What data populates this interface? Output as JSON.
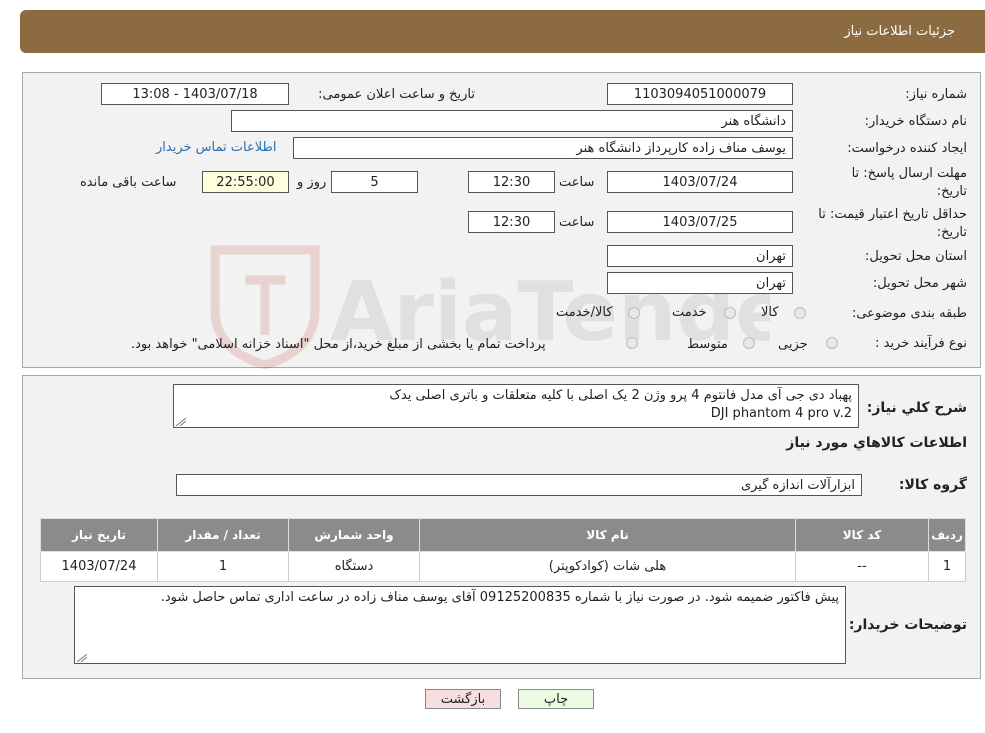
{
  "header": {
    "title": "جزئیات اطلاعات نیاز"
  },
  "fields": {
    "need_number_label": "شماره نیاز:",
    "need_number": "1103094051000079",
    "announce_label": "تاریخ و ساعت اعلان عمومی:",
    "announce_value": "1403/07/18 - 13:08",
    "buyer_org_label": "نام دستگاه خریدار:",
    "buyer_org": "دانشگاه هنر",
    "creator_label": "ایجاد کننده درخواست:",
    "creator": "یوسف مناف زاده کارپرداز دانشگاه هنر",
    "contact_link": "اطلاعات تماس خریدار",
    "deadline_label_1": "مهلت ارسال پاسخ: تا",
    "deadline_label_2": "تاریخ:",
    "deadline_date": "1403/07/24",
    "time_label": "ساعت",
    "deadline_time": "12:30",
    "days_value": "5",
    "days_label": "روز و",
    "remaining_time": "22:55:00",
    "remaining_label": "ساعت باقی مانده",
    "validity_label_1": "حداقل تاریخ اعتبار قیمت: تا",
    "validity_label_2": "تاریخ:",
    "validity_date": "1403/07/25",
    "validity_time": "12:30",
    "province_label": "استان محل تحویل:",
    "province": "تهران",
    "city_label": "شهر محل تحویل:",
    "city": "تهران",
    "category_label": "طبقه بندی موضوعی:",
    "category_options": [
      "کالا",
      "خدمت",
      "کالا/خدمت"
    ],
    "process_label": "نوع فرآیند خرید :",
    "process_options": [
      "جزیی",
      "متوسط"
    ],
    "process_note": "پرداخت تمام یا بخشی از مبلغ خرید،از محل \"اسناد خزانه اسلامی\" خواهد بود."
  },
  "details": {
    "summary_label": "شرح کلي نياز:",
    "summary_line1": "پهباد دی جی آی مدل فانتوم 4 پرو وژن 2  یک اصلی با کلیه متعلقات و باتری  اصلی یدک",
    "summary_line2": "DJI phantom 4 pro v.2",
    "goods_info_title": "اطلاعات کالاهاي مورد نياز",
    "group_label": "گروه کالا:",
    "group_value": "ابزارآلات اندازه گیری",
    "table": {
      "headers": [
        "ردیف",
        "کد کالا",
        "نام کالا",
        "واحد شمارش",
        "تعداد / مقدار",
        "تاریخ نیاز"
      ],
      "rows": [
        [
          "1",
          "--",
          "هلی شات (کوادکوپتر)",
          "دستگاه",
          "1",
          "1403/07/24"
        ]
      ]
    },
    "buyer_notes_label": "توضیحات خریدار:",
    "buyer_notes": "پیش فاکتور ضمیمه شود. در صورت نیاز با شماره 09125200835 آقای یوسف مناف زاده در ساعت اداری تماس حاصل شود."
  },
  "buttons": {
    "print": "چاپ",
    "back": "بازگشت"
  },
  "colors": {
    "header": "#8b6b3f",
    "table_header": "#8b8b8b",
    "link": "#2a6fb5",
    "back_button": "#f6dede",
    "print_button": "#eafbe4"
  },
  "watermark": {
    "text": "AriaTender.neT"
  }
}
